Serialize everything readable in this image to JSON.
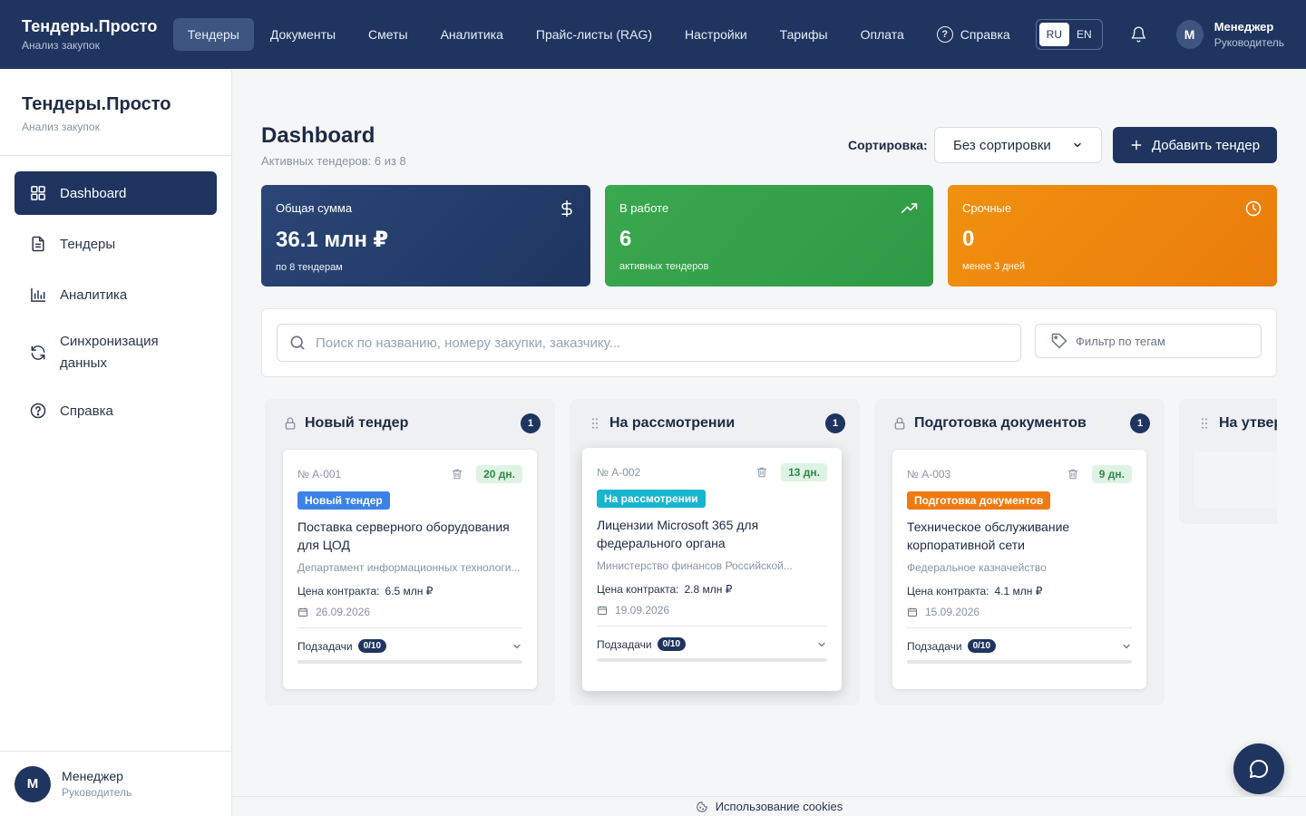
{
  "topbar": {
    "brand_title": "Тендеры.Просто",
    "brand_sub": "Анализ закупок",
    "nav": [
      "Тендеры",
      "Документы",
      "Сметы",
      "Аналитика",
      "Прайс-листы (RAG)",
      "Настройки",
      "Тарифы",
      "Оплата"
    ],
    "help": "Справка",
    "lang": [
      "RU",
      "EN"
    ],
    "avatar_letter": "M",
    "user_name": "Менеджер",
    "user_role": "Руководитель"
  },
  "sidebar": {
    "brand_title": "Тендеры.Просто",
    "brand_sub": "Анализ закупок",
    "items": [
      {
        "label": "Dashboard",
        "icon": "grid-icon"
      },
      {
        "label": "Тендеры",
        "icon": "document-icon"
      },
      {
        "label": "Аналитика",
        "icon": "bar-chart-icon"
      },
      {
        "label": "Синхронизация данных",
        "icon": "sync-icon"
      },
      {
        "label": "Справка",
        "icon": "help-icon"
      }
    ],
    "avatar_letter": "M",
    "user_name": "Менеджер",
    "user_role": "Руководитель"
  },
  "main": {
    "title": "Dashboard",
    "subtitle": "Активных тендеров: 6 из 8",
    "sort_label": "Сортировка:",
    "sort_value": "Без сортировки",
    "add_button": "Добавить тендер",
    "stats": [
      {
        "label": "Общая сумма",
        "value": "36.1 млн ₽",
        "sub": "по 8 тендерам",
        "icon": "dollar-icon",
        "color": "#1f3560"
      },
      {
        "label": "В работе",
        "value": "6",
        "sub": "активных тендеров",
        "icon": "trending-up-icon",
        "color": "#34a24b"
      },
      {
        "label": "Срочные",
        "value": "0",
        "sub": "менее 3 дней",
        "icon": "clock-icon",
        "color": "#ee870e"
      }
    ],
    "search_placeholder": "Поиск по названию, номеру закупки, заказчику...",
    "tag_filter": "Фильтр по тегам"
  },
  "board": {
    "columns": [
      {
        "title": "Новый тендер",
        "icon": "lock-icon",
        "count": "1"
      },
      {
        "title": "На рассмотрении",
        "icon": "drag-handle-icon",
        "count": "1"
      },
      {
        "title": "Подготовка документов",
        "icon": "lock-icon",
        "count": "1"
      },
      {
        "title": "На утвер",
        "icon": "drag-handle-icon",
        "count": ""
      }
    ],
    "cards": [
      {
        "num": "№ А-001",
        "days": "20 дн.",
        "status": "Новый тендер",
        "status_color": "#3b82e6",
        "title": "Поставка серверного оборудования для ЦОД",
        "customer": "Департамент информационных технологи...",
        "price_label": "Цена контракта:",
        "price": "6.5 млн ₽",
        "date": "26.09.2026",
        "subtasks_label": "Подзадачи",
        "subtasks": "0/10"
      },
      {
        "num": "№ А-002",
        "days": "13 дн.",
        "status": "На рассмотрении",
        "status_color": "#17b5cf",
        "title": "Лицензии Microsoft 365 для федерального органа",
        "customer": "Министерство финансов Российской...",
        "price_label": "Цена контракта:",
        "price": "2.8 млн ₽",
        "date": "19.09.2026",
        "subtasks_label": "Подзадачи",
        "subtasks": "0/10"
      },
      {
        "num": "№ А-003",
        "days": "9 дн.",
        "status": "Подготовка документов",
        "status_color": "#f07a12",
        "title": "Техническое обслуживание корпоративной сети",
        "customer": "Федеральное казначейство",
        "price_label": "Цена контракта:",
        "price": "4.1 млн ₽",
        "date": "15.09.2026",
        "subtasks_label": "Подзадачи",
        "subtasks": "0/10"
      }
    ]
  },
  "cookies": "Использование cookies"
}
